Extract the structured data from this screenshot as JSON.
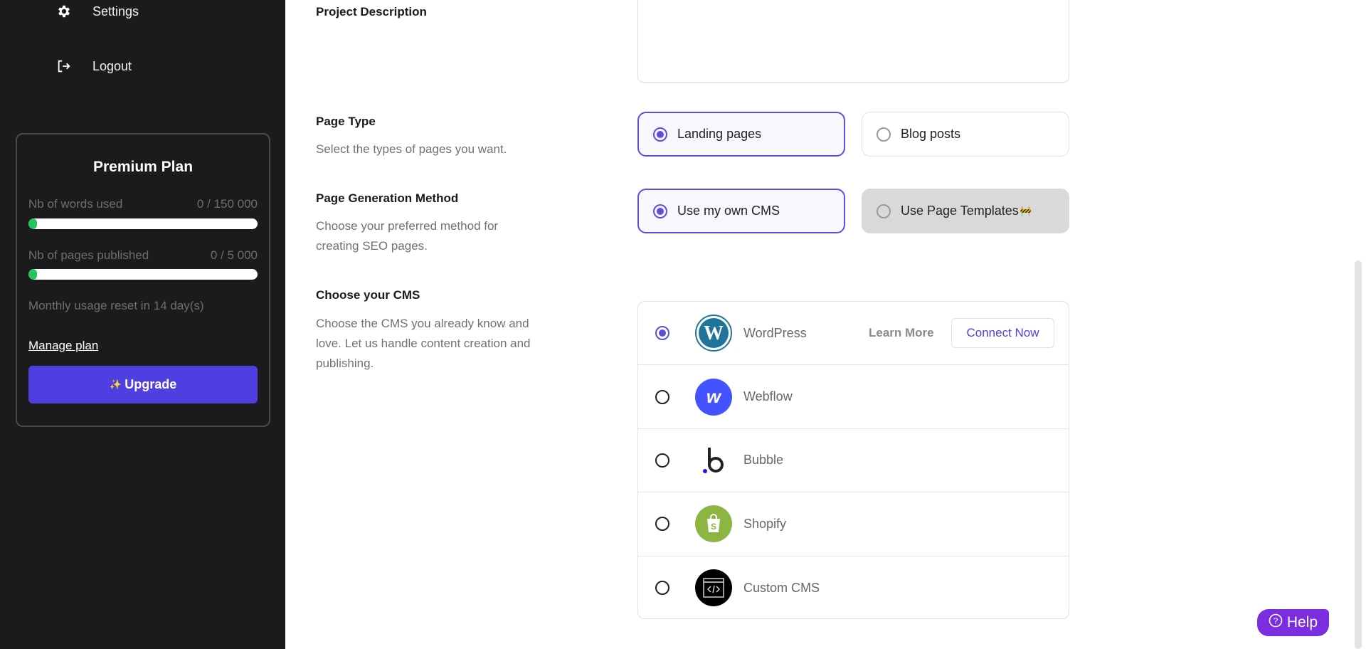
{
  "sidebar": {
    "nav": [
      {
        "label": "Settings",
        "icon": "gear-icon"
      },
      {
        "label": "Logout",
        "icon": "logout-icon"
      }
    ],
    "plan": {
      "title": "Premium Plan",
      "words_label": "Nb of words used",
      "words_value": "0 / 150 000",
      "words_progress": 0,
      "pages_label": "Nb of pages published",
      "pages_value": "0 / 5 000",
      "pages_progress": 0,
      "reset_text": "Monthly usage reset in 14 day(s)",
      "manage_label": "Manage plan",
      "upgrade_label": "Upgrade",
      "upgrade_icon": "✨"
    }
  },
  "main": {
    "project_description": {
      "label": "Project Description",
      "value": ""
    },
    "page_type": {
      "label": "Page Type",
      "subtitle": "Select the types of pages you want.",
      "options": [
        {
          "label": "Landing pages",
          "selected": true
        },
        {
          "label": "Blog posts",
          "selected": false
        }
      ]
    },
    "generation_method": {
      "label": "Page Generation Method",
      "subtitle": "Choose your preferred method for creating SEO pages.",
      "options": [
        {
          "label": "Use my own CMS",
          "selected": true
        },
        {
          "label": "Use Page Templates",
          "selected": false,
          "disabled": true,
          "emoji": "🚧"
        }
      ]
    },
    "cms": {
      "label": "Choose your CMS",
      "subtitle": "Choose the CMS you already know and love. Let us handle content creation and publishing.",
      "learn_more": "Learn More",
      "connect_now": "Connect Now",
      "items": [
        {
          "name": "WordPress",
          "selected": true
        },
        {
          "name": "Webflow",
          "selected": false
        },
        {
          "name": "Bubble",
          "selected": false
        },
        {
          "name": "Shopify",
          "selected": false
        },
        {
          "name": "Custom CMS",
          "selected": false
        }
      ]
    }
  },
  "help": {
    "label": "Help"
  },
  "colors": {
    "accent": "#5b4fe0",
    "upgrade": "#4f3ee0",
    "help": "#7b2ee0",
    "progress": "#22c55e",
    "sidebar": "#1b1b1d"
  }
}
